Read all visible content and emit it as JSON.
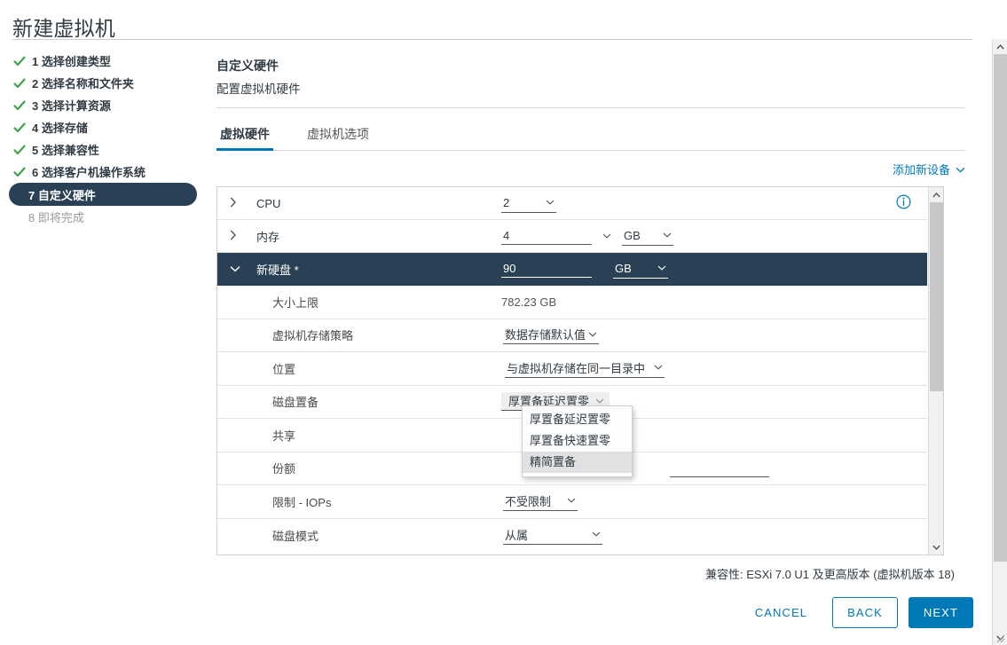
{
  "window": {
    "title": "新建虚拟机"
  },
  "steps": [
    {
      "num": "1",
      "label": "1 选择创建类型",
      "state": "done"
    },
    {
      "num": "2",
      "label": "2 选择名称和文件夹",
      "state": "done"
    },
    {
      "num": "3",
      "label": "3 选择计算资源",
      "state": "done"
    },
    {
      "num": "4",
      "label": "4 选择存储",
      "state": "done"
    },
    {
      "num": "5",
      "label": "5 选择兼容性",
      "state": "done"
    },
    {
      "num": "6",
      "label": "6 选择客户机操作系统",
      "state": "done"
    },
    {
      "num": "7",
      "label": "7 自定义硬件",
      "state": "active"
    },
    {
      "num": "8",
      "label": "8 即将完成",
      "state": "upcoming"
    }
  ],
  "content": {
    "title": "自定义硬件",
    "subtitle": "配置虚拟机硬件",
    "tabs": [
      {
        "label": "虚拟硬件",
        "active": true
      },
      {
        "label": "虚拟机选项",
        "active": false
      }
    ],
    "add_device_label": "添加新设备",
    "add_device_chevron": "chevron-down-icon"
  },
  "hardware": {
    "cpu": {
      "label": "CPU",
      "value": "2",
      "twisty": "collapsed",
      "info_icon": "info-circle-icon"
    },
    "memory": {
      "label": "内存",
      "value": "4",
      "unit": "GB",
      "twisty": "collapsed"
    },
    "new_hard_disk": {
      "label": "新硬盘 *",
      "value": "90",
      "unit": "GB",
      "twisty": "expanded",
      "selected": true
    },
    "rows": [
      {
        "label": "大小上限",
        "type": "readonly",
        "value": "782.23 GB"
      },
      {
        "label": "虚拟机存储策略",
        "type": "select",
        "value": "数据存储默认值"
      },
      {
        "label": "位置",
        "type": "select",
        "value": "与虚拟机存储在同一目录中"
      },
      {
        "label": "磁盘置备",
        "type": "select-open",
        "value": "厚置备延迟置零"
      },
      {
        "label": "共享",
        "type": "hidden",
        "value": ""
      },
      {
        "label": "份额",
        "type": "ghost",
        "value": ""
      },
      {
        "label": "限制 - IOPs",
        "type": "select",
        "value": "不受限制"
      },
      {
        "label": "磁盘模式",
        "type": "select",
        "value": "从属"
      }
    ]
  },
  "dropdown": {
    "open": true,
    "options": [
      {
        "label": "厚置备延迟置零",
        "highlight": false
      },
      {
        "label": "厚置备快速置零",
        "highlight": false
      },
      {
        "label": "精简置备",
        "highlight": true
      }
    ]
  },
  "footer": {
    "compatibility": "兼容性: ESXi 7.0 U1 及更高版本 (虚拟机版本 18)",
    "cancel_label": "CANCEL",
    "back_label": "BACK",
    "next_label": "NEXT"
  },
  "colors": {
    "accent_blue": "#0079b8",
    "selected_row": "#2a4054",
    "check_green": "#3ea34a"
  }
}
